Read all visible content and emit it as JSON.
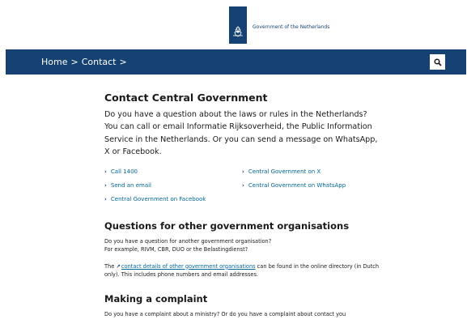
{
  "header": {
    "logo_text": "Government of the Netherlands"
  },
  "nav": {
    "breadcrumb_home": "Home",
    "breadcrumb_separator": ">",
    "breadcrumb_current": "Contact",
    "search_icon": "search-icon"
  },
  "main": {
    "title": "Contact Central Government",
    "intro": "Do you have a question about the laws or rules in the Netherlands? You can call or email Informatie Rijksoverheid, the Public Information Service in the Netherlands. Or you can send a message on WhatsApp, X or Facebook.",
    "links": [
      {
        "label": "Call 1400"
      },
      {
        "label": "Send an email"
      },
      {
        "label": "Central Government on Facebook"
      },
      {
        "label": "Central Government on X"
      },
      {
        "label": "Central Government on WhatsApp"
      }
    ],
    "other_orgs": {
      "heading": "Questions for other government organisations",
      "line1": "Do you have a question for another government organisation?",
      "line2": "For example, RIVM, CBR, DUO or the Belastingdienst?",
      "prefix": "The",
      "link_text": "contact details of other government organisations",
      "suffix": "can be found in the online directory (in Dutch only). This includes phone numbers and email addresses."
    },
    "complaint": {
      "heading": "Making a complaint",
      "line1": "Do you have a complaint about a ministry? Or do you have a complaint about contact you"
    }
  },
  "colors": {
    "brand_blue": "#154273",
    "link_blue": "#01689b"
  }
}
